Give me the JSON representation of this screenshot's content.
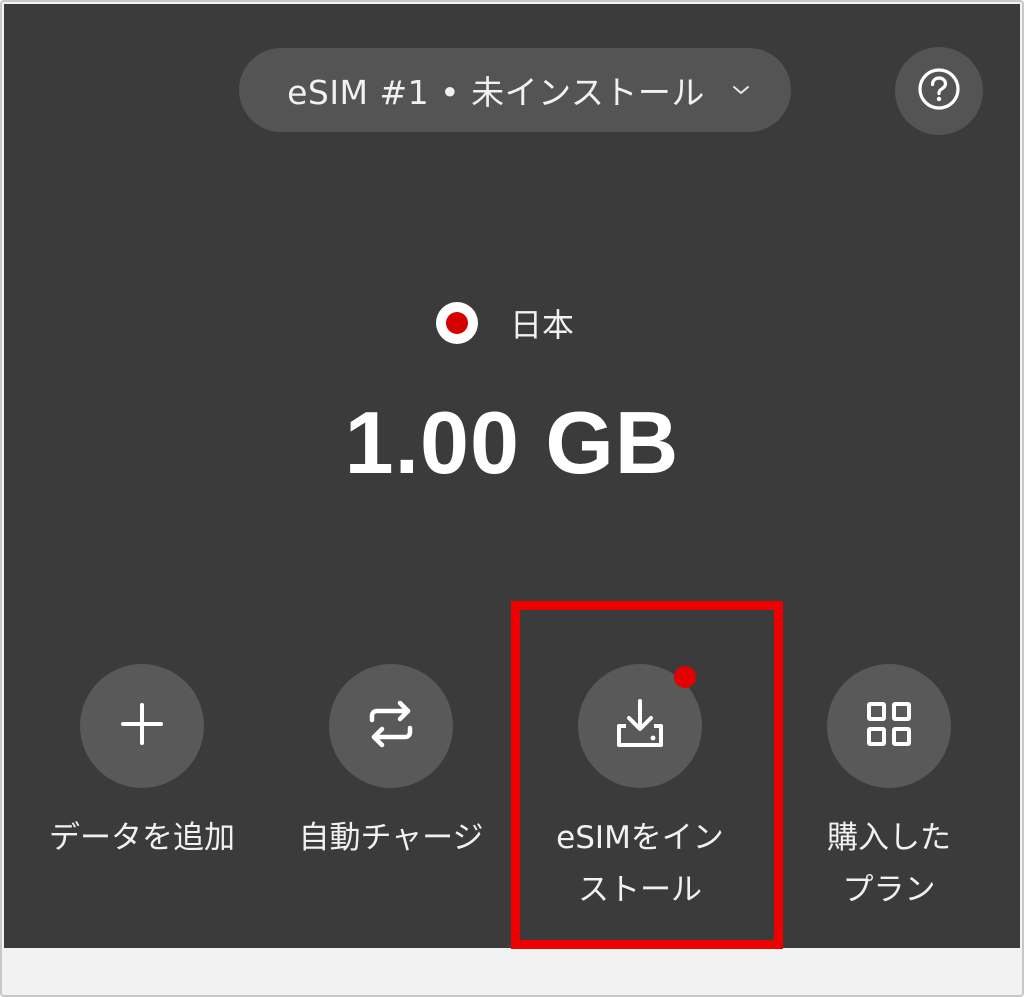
{
  "header": {
    "esim_selector": "eSIM #1 • 未インストール"
  },
  "country": {
    "name": "日本",
    "flag_icon": "japan-flag-icon"
  },
  "data_remaining": "1.00 GB",
  "actions": [
    {
      "label": "データを追加",
      "icon": "plus-icon"
    },
    {
      "label": "自動チャージ",
      "icon": "repeat-icon"
    },
    {
      "label": "eSIMをイン\nストール",
      "icon": "download-icon",
      "badge": true
    },
    {
      "label": "購入した\nプラン",
      "icon": "grid-icon"
    }
  ],
  "colors": {
    "background": "#3b3b3b",
    "button": "#595959",
    "accent_red": "#e30000",
    "highlight": "#ee0000"
  }
}
